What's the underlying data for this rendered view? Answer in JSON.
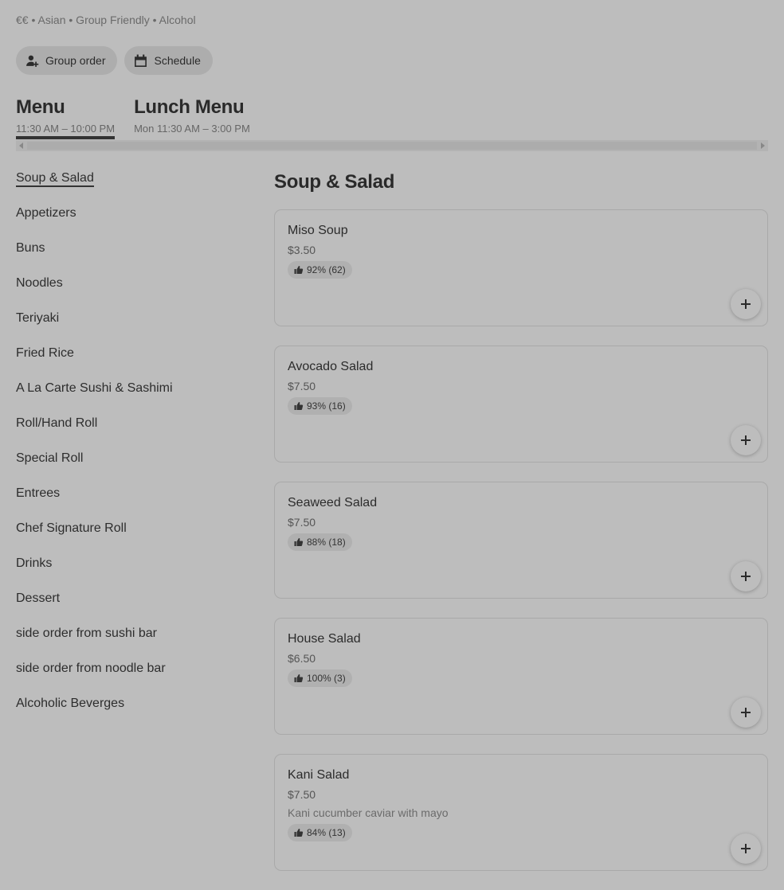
{
  "header": {
    "tagline": "€€ • Asian • Group Friendly • Alcohol",
    "group_order_label": "Group order",
    "schedule_label": "Schedule"
  },
  "menus": [
    {
      "title": "Menu",
      "hours": "11:30 AM – 10:00 PM",
      "active": true
    },
    {
      "title": "Lunch Menu",
      "hours": "Mon 11:30 AM – 3:00 PM",
      "active": false
    }
  ],
  "sidebar": {
    "categories": [
      "Soup & Salad",
      "Appetizers",
      "Buns",
      "Noodles",
      "Teriyaki",
      "Fried Rice",
      "A La Carte Sushi & Sashimi",
      "Roll/Hand Roll",
      "Special Roll",
      "Entrees",
      "Chef Signature Roll",
      "Drinks",
      "Dessert",
      "side order from sushi bar",
      "side order from noodle bar",
      "Alcoholic Beverges"
    ],
    "active_index": 0
  },
  "section": {
    "title": "Soup & Salad",
    "items": [
      {
        "name": "Miso Soup",
        "price": "$3.50",
        "rating": "92% (62)"
      },
      {
        "name": "Avocado Salad",
        "price": "$7.50",
        "rating": "93% (16)"
      },
      {
        "name": "Seaweed Salad",
        "price": "$7.50",
        "rating": "88% (18)"
      },
      {
        "name": "House Salad",
        "price": "$6.50",
        "rating": "100% (3)"
      },
      {
        "name": "Kani Salad",
        "price": "$7.50",
        "description": "Kani cucumber caviar with mayo",
        "rating": "84% (13)"
      }
    ]
  },
  "icons": {
    "group_order": "add-person-icon",
    "schedule": "calendar-icon",
    "rating": "thumbs-up-icon",
    "add": "plus-icon"
  }
}
